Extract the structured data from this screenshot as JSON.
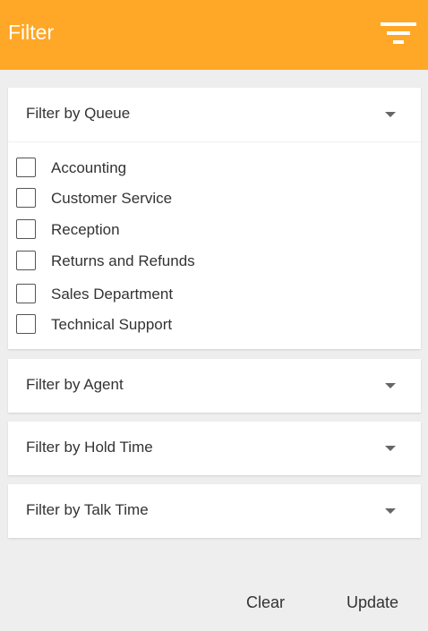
{
  "header": {
    "title": "Filter",
    "icon": "filter-icon",
    "background_color": "#ffa726"
  },
  "panels": [
    {
      "title": "Filter by Queue",
      "expanded": true,
      "options": [
        {
          "label": "Accounting",
          "checked": false
        },
        {
          "label": "Customer Service",
          "checked": false
        },
        {
          "label": "Reception",
          "checked": false
        },
        {
          "label": "Returns and Refunds",
          "checked": false
        },
        {
          "label": "Sales Department",
          "checked": false
        },
        {
          "label": "Technical Support",
          "checked": false
        }
      ]
    },
    {
      "title": "Filter by Agent",
      "expanded": false
    },
    {
      "title": "Filter by Hold Time",
      "expanded": false
    },
    {
      "title": "Filter by Talk Time",
      "expanded": false
    }
  ],
  "footer": {
    "clear_label": "Clear",
    "update_label": "Update"
  }
}
